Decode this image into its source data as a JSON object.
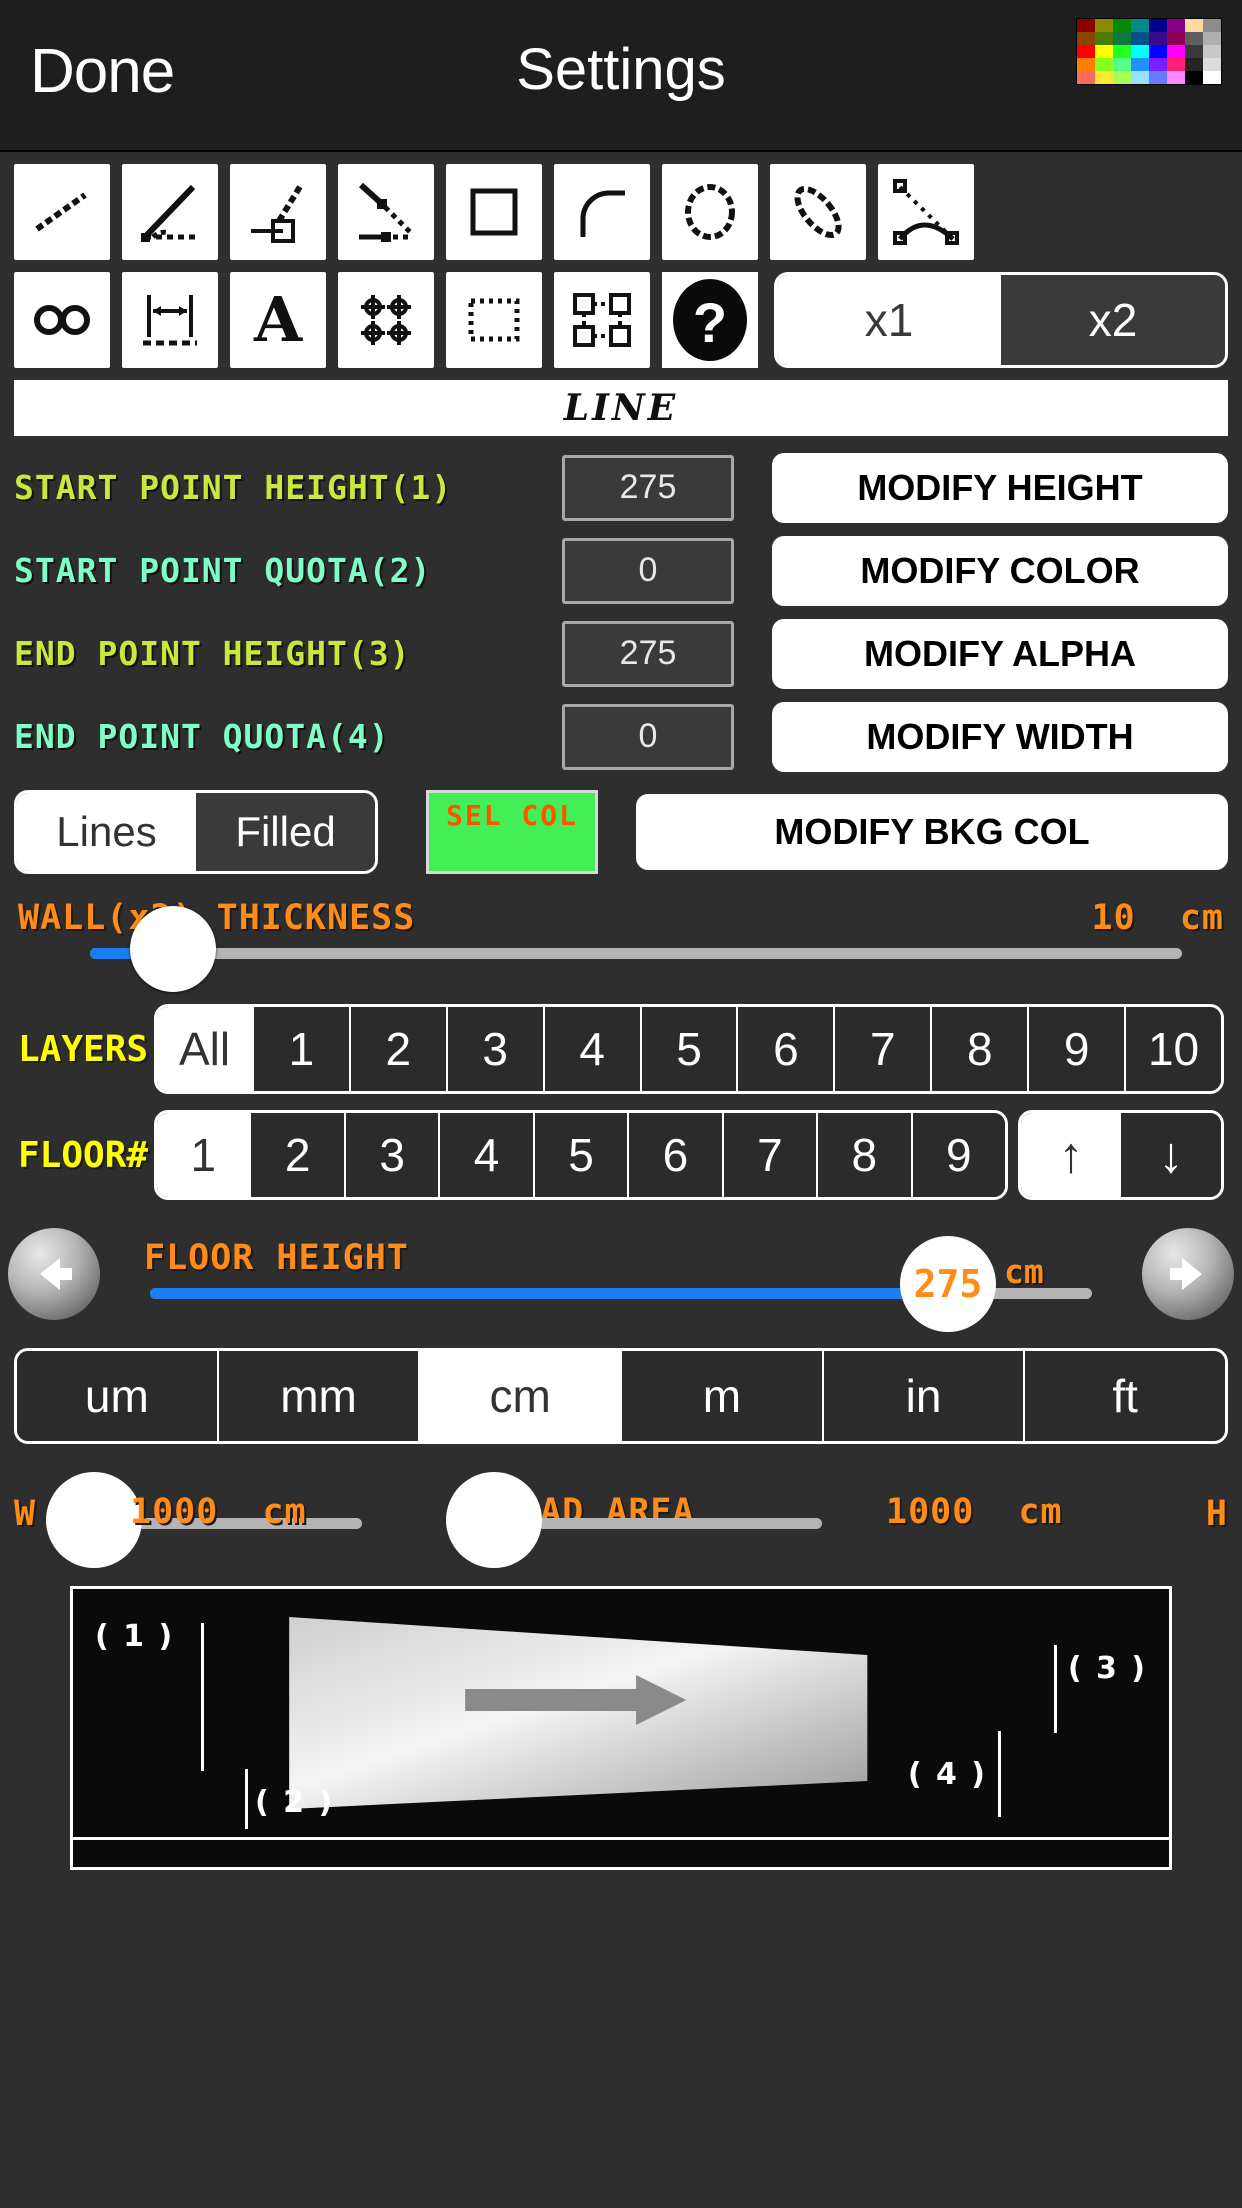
{
  "navbar": {
    "done_label": "Done",
    "title": "Settings",
    "palette_name": "color-palette-swatch",
    "palette_colors": [
      [
        "#8b0000",
        "#8b8b00",
        "#008b00",
        "#008b8b",
        "#00008b",
        "#8b008b",
        "#ffd9a0",
        "#8c8c8c"
      ],
      [
        "#8b4500",
        "#4a7a00",
        "#0f7a3d",
        "#00528b",
        "#3a0a8b",
        "#8b0050",
        "#5e5e5e",
        "#b0b0b0"
      ],
      [
        "#ff0000",
        "#ffff00",
        "#22ff22",
        "#00ffff",
        "#0000ff",
        "#ff00ff",
        "#3a3a3a",
        "#c8c8c8"
      ],
      [
        "#ff7f00",
        "#8aff1e",
        "#55ff88",
        "#1e90ff",
        "#7a1eff",
        "#ff1e78",
        "#242424",
        "#dcdcdc"
      ],
      [
        "#ff6a5a",
        "#ffe833",
        "#aaff55",
        "#99e0ff",
        "#6a7aff",
        "#ff88ff",
        "#000000",
        "#ffffff"
      ]
    ]
  },
  "toolbar": {
    "row1": [
      {
        "name": "line-tool",
        "label": "line"
      },
      {
        "name": "angle-line-tool",
        "label": "angle-line"
      },
      {
        "name": "line-to-box-tool",
        "label": "line-to-box"
      },
      {
        "name": "polyline-tool",
        "label": "polyline"
      },
      {
        "name": "rectangle-tool",
        "label": "rectangle"
      },
      {
        "name": "arc-tool",
        "label": "arc"
      },
      {
        "name": "circle-tool",
        "label": "circle"
      },
      {
        "name": "ellipse-tool",
        "label": "ellipse"
      },
      {
        "name": "curve-area-tool",
        "label": "curve-area"
      }
    ],
    "row2": [
      {
        "name": "infinity-tool",
        "label": "infinity"
      },
      {
        "name": "dimension-tool",
        "label": "dimension"
      },
      {
        "name": "text-tool",
        "label": "text"
      },
      {
        "name": "grid-points-tool",
        "label": "grid-points"
      },
      {
        "name": "selection-tool",
        "label": "selection"
      },
      {
        "name": "group-objects-tool",
        "label": "group-objects"
      },
      {
        "name": "help-tool",
        "label": "help"
      }
    ],
    "zoom_segments": [
      {
        "label": "x1",
        "selected": false
      },
      {
        "label": "x2",
        "selected": true
      }
    ]
  },
  "entity": {
    "type_label": "LINE"
  },
  "params": {
    "rows": [
      {
        "label": "START POINT HEIGHT(1)",
        "color": "#c8e83c",
        "value": "275",
        "button": "MODIFY HEIGHT"
      },
      {
        "label": "START POINT QUOTA(2)",
        "color": "#7fffc8",
        "value": "0",
        "button": "MODIFY COLOR"
      },
      {
        "label": "END POINT HEIGHT(3)",
        "color": "#c8e83c",
        "value": "275",
        "button": "MODIFY ALPHA"
      },
      {
        "label": "END POINT QUOTA(4)",
        "color": "#7fffc8",
        "value": "0",
        "button": "MODIFY WIDTH"
      }
    ]
  },
  "fill_mode": {
    "options": [
      {
        "label": "Lines",
        "selected": true
      },
      {
        "label": "Filled",
        "selected": false
      }
    ],
    "sel_col_label": "SEL COL",
    "sel_col_value": "#44ee55",
    "sel_col_text_color": "#ff5500",
    "bkg_button": "MODIFY BKG COL"
  },
  "wall_thickness": {
    "label": "WALL(x2) THICKNESS",
    "value": "10",
    "unit": "cm",
    "accent": "#ff8c19"
  },
  "layers": {
    "label": "LAYERS",
    "options": [
      "All",
      "1",
      "2",
      "3",
      "4",
      "5",
      "6",
      "7",
      "8",
      "9",
      "10"
    ],
    "selected": "All"
  },
  "floor": {
    "label": "FLOOR#",
    "options": [
      "1",
      "2",
      "3",
      "4",
      "5",
      "6",
      "7",
      "8",
      "9"
    ],
    "selected": "1",
    "up_arrow": "↑",
    "down_arrow": "↓",
    "up_selected": true
  },
  "floor_height": {
    "label": "FLOOR HEIGHT",
    "value": "275",
    "unit": "cm",
    "prev_name": "prev-arrow-button",
    "next_name": "next-arrow-button"
  },
  "units": {
    "options": [
      "um",
      "mm",
      "cm",
      "m",
      "in",
      "ft"
    ],
    "selected": "cm"
  },
  "cad_area": {
    "title": "CAD AREA",
    "width_letter": "W",
    "width_value": "1000",
    "width_unit": "cm",
    "height_letter": "H",
    "height_value": "1000",
    "height_unit": "cm"
  },
  "preview": {
    "labels": [
      "( 1 )",
      "( 2 )",
      "( 3 )",
      "( 4 )"
    ],
    "shape_name": "wall-preview-shape",
    "direction_arrow_name": "direction-arrow"
  }
}
